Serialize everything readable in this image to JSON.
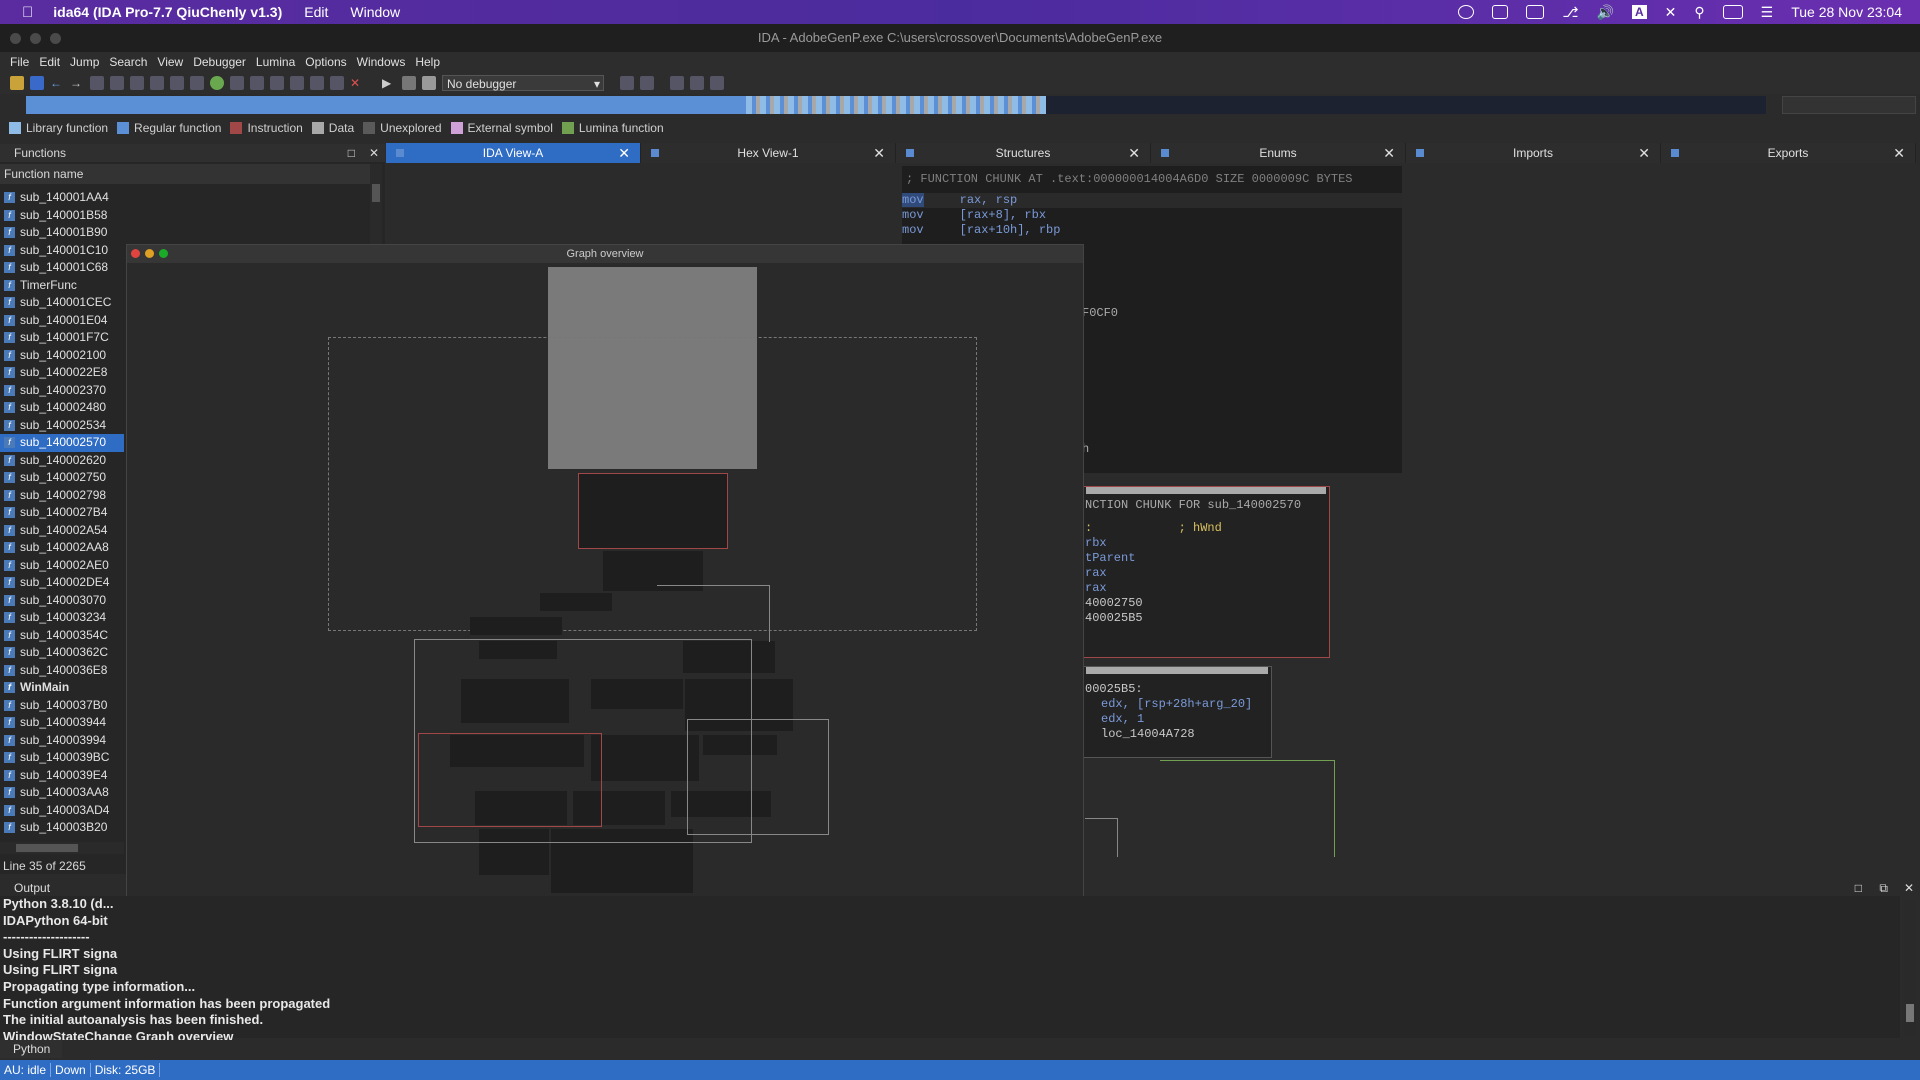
{
  "macos": {
    "app_name": "ida64 (IDA Pro-7.7 QiuChenly v1.3)",
    "menus": [
      "Edit",
      "Window"
    ],
    "datetime": "Tue 28 Nov  23:04"
  },
  "window_title": "IDA - AdobeGenP.exe C:\\users\\crossover\\Documents\\AdobeGenP.exe",
  "menu": [
    "File",
    "Edit",
    "Jump",
    "Search",
    "View",
    "Debugger",
    "Lumina",
    "Options",
    "Windows",
    "Help"
  ],
  "toolbar": {
    "debugger_select": "No debugger"
  },
  "legend": [
    {
      "label": "Library function",
      "color": "#8fbce6"
    },
    {
      "label": "Regular function",
      "color": "#5b8fd6"
    },
    {
      "label": "Instruction",
      "color": "#a04848"
    },
    {
      "label": "Data",
      "color": "#a8a8a8"
    },
    {
      "label": "Unexplored",
      "color": "#5a5a5a"
    },
    {
      "label": "External symbol",
      "color": "#d0a0d8"
    },
    {
      "label": "Lumina function",
      "color": "#70a050"
    }
  ],
  "functions": {
    "title": "Functions",
    "column": "Function name",
    "items": [
      "sub_140001AA4",
      "sub_140001B58",
      "sub_140001B90",
      "sub_140001C10",
      "sub_140001C68",
      "TimerFunc",
      "sub_140001CEC",
      "sub_140001E04",
      "sub_140001F7C",
      "sub_140002100",
      "sub_1400022E8",
      "sub_140002370",
      "sub_140002480",
      "sub_140002534",
      "sub_140002570",
      "sub_140002620",
      "sub_140002750",
      "sub_140002798",
      "sub_1400027B4",
      "sub_140002A54",
      "sub_140002AA8",
      "sub_140002AE0",
      "sub_140002DE4",
      "sub_140003070",
      "sub_140003234",
      "sub_14000354C",
      "sub_14000362C",
      "sub_1400036E8",
      "WinMain",
      "sub_1400037B0",
      "sub_140003944",
      "sub_140003994",
      "sub_1400039BC",
      "sub_1400039E4",
      "sub_140003AA8",
      "sub_140003AD4",
      "sub_140003B20"
    ],
    "selected": "sub_140002570",
    "bold": [
      "WinMain"
    ],
    "line_status": "Line 35 of 2265"
  },
  "tabs": [
    {
      "label": "IDA View-A",
      "active": true
    },
    {
      "label": "Hex View-1",
      "active": false
    },
    {
      "label": "Structures",
      "active": false
    },
    {
      "label": "Enums",
      "active": false
    },
    {
      "label": "Imports",
      "active": false
    },
    {
      "label": "Exports",
      "active": false
    }
  ],
  "disasm": {
    "header": "; FUNCTION CHUNK AT .text:000000014004A6D0 SIZE 0000009C BYTES",
    "lines": [
      {
        "op": "mov",
        "args": "rax, rsp"
      },
      {
        "op": "mov",
        "args": "[rax+8], rbx"
      },
      {
        "op": "mov",
        "args": "[rax+10h], rbp"
      }
    ],
    "frag_0CF0": "F0CF0",
    "frag_h": "h",
    "block2_header": "NCTION CHUNK FOR sub_140002570",
    "block2_lines": [
      ":            ; hWnd",
      "rbx",
      "tParent",
      "rax",
      "rax",
      "40002750",
      "",
      "400025B5"
    ],
    "block3_lines": [
      "00025B5:",
      "edx, [rsp+28h+arg_20]",
      "edx, 1",
      "loc_14004A728"
    ]
  },
  "graph_overview": {
    "title": "Graph overview"
  },
  "output": {
    "title": "Output",
    "lines": [
      "Python 3.8.10 (d...",
      "IDAPython 64-bit",
      "--------------------",
      "Using FLIRT signa",
      "Using FLIRT signa",
      "Propagating type information...",
      "Function argument information has been propagated",
      "The initial autoanalysis has been finished.",
      "WindowStateChange Graph overview"
    ],
    "lang_tab": "Python"
  },
  "status": [
    "AU:  idle",
    "Down",
    "Disk: 25GB"
  ]
}
